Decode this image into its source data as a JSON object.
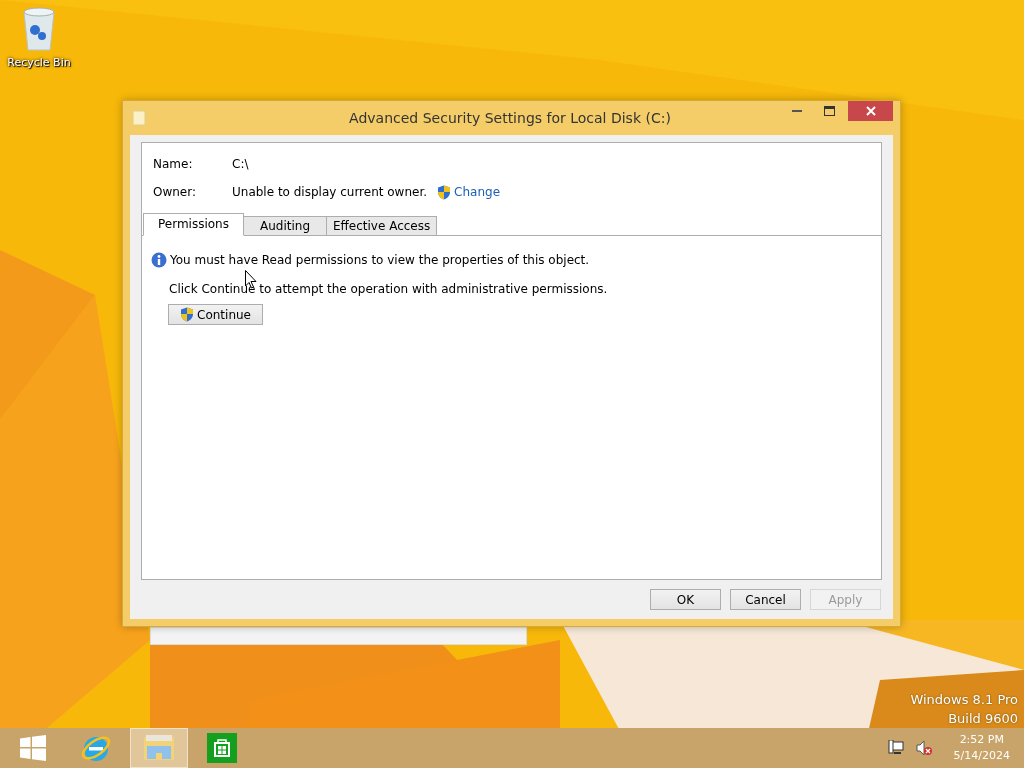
{
  "desktop": {
    "icons": [
      {
        "label": "Recycle Bin"
      }
    ]
  },
  "window": {
    "title": "Advanced Security Settings for Local Disk (C:)",
    "fields": [
      {
        "label": "Name:",
        "value": "C:\\"
      },
      {
        "label": "Owner:",
        "value": "Unable to display current owner.",
        "link": "Change"
      }
    ],
    "tabs": [
      {
        "label": "Permissions",
        "selected": true
      },
      {
        "label": "Auditing",
        "selected": false
      },
      {
        "label": "Effective Access",
        "selected": false
      }
    ],
    "info_message": "You must have Read permissions to view the properties of this object.",
    "instruction": "Click Continue to attempt the operation with administrative permissions.",
    "continue_button": "Continue",
    "buttons": [
      {
        "label": "OK",
        "disabled": false
      },
      {
        "label": "Cancel",
        "disabled": false
      },
      {
        "label": "Apply",
        "disabled": true
      }
    ]
  },
  "edition_notice": {
    "edition": "Windows 8.1 Pro",
    "build": "Build 9600"
  },
  "taskbar": {
    "apps": [
      {
        "kind": "start",
        "selected": false
      },
      {
        "kind": "browser",
        "selected": false
      },
      {
        "kind": "explorer",
        "selected": true
      },
      {
        "kind": "store",
        "selected": false
      }
    ],
    "clock": {
      "time": "2:52 PM",
      "date": "5/14/2024"
    }
  }
}
